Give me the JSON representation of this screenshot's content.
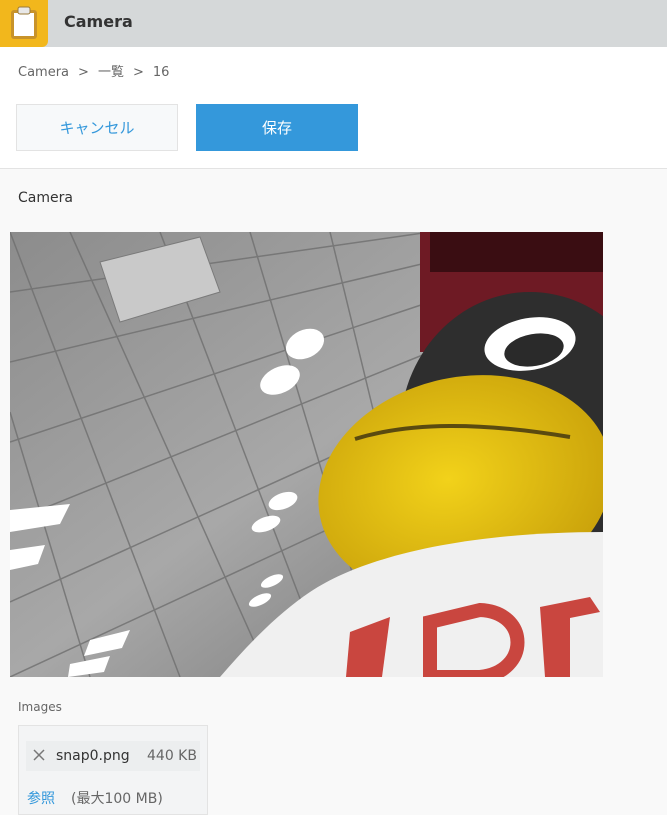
{
  "app": {
    "title": "Camera",
    "icon": "clipboard-icon"
  },
  "breadcrumb": {
    "items": [
      "Camera",
      "一覧",
      "16"
    ],
    "separator": ">"
  },
  "toolbar": {
    "cancel_label": "キャンセル",
    "save_label": "保存"
  },
  "field": {
    "label": "Camera"
  },
  "photo": {
    "description_icon": "camera-photo"
  },
  "images": {
    "label": "Images",
    "file": {
      "name": "snap0.png",
      "size": "440 KB"
    },
    "browse_label": "参照",
    "max_size": "(最大100 MB)"
  },
  "colors": {
    "accent": "#3498db",
    "header_bg": "#d5d8d9",
    "icon_bg": "#f2b71c"
  }
}
